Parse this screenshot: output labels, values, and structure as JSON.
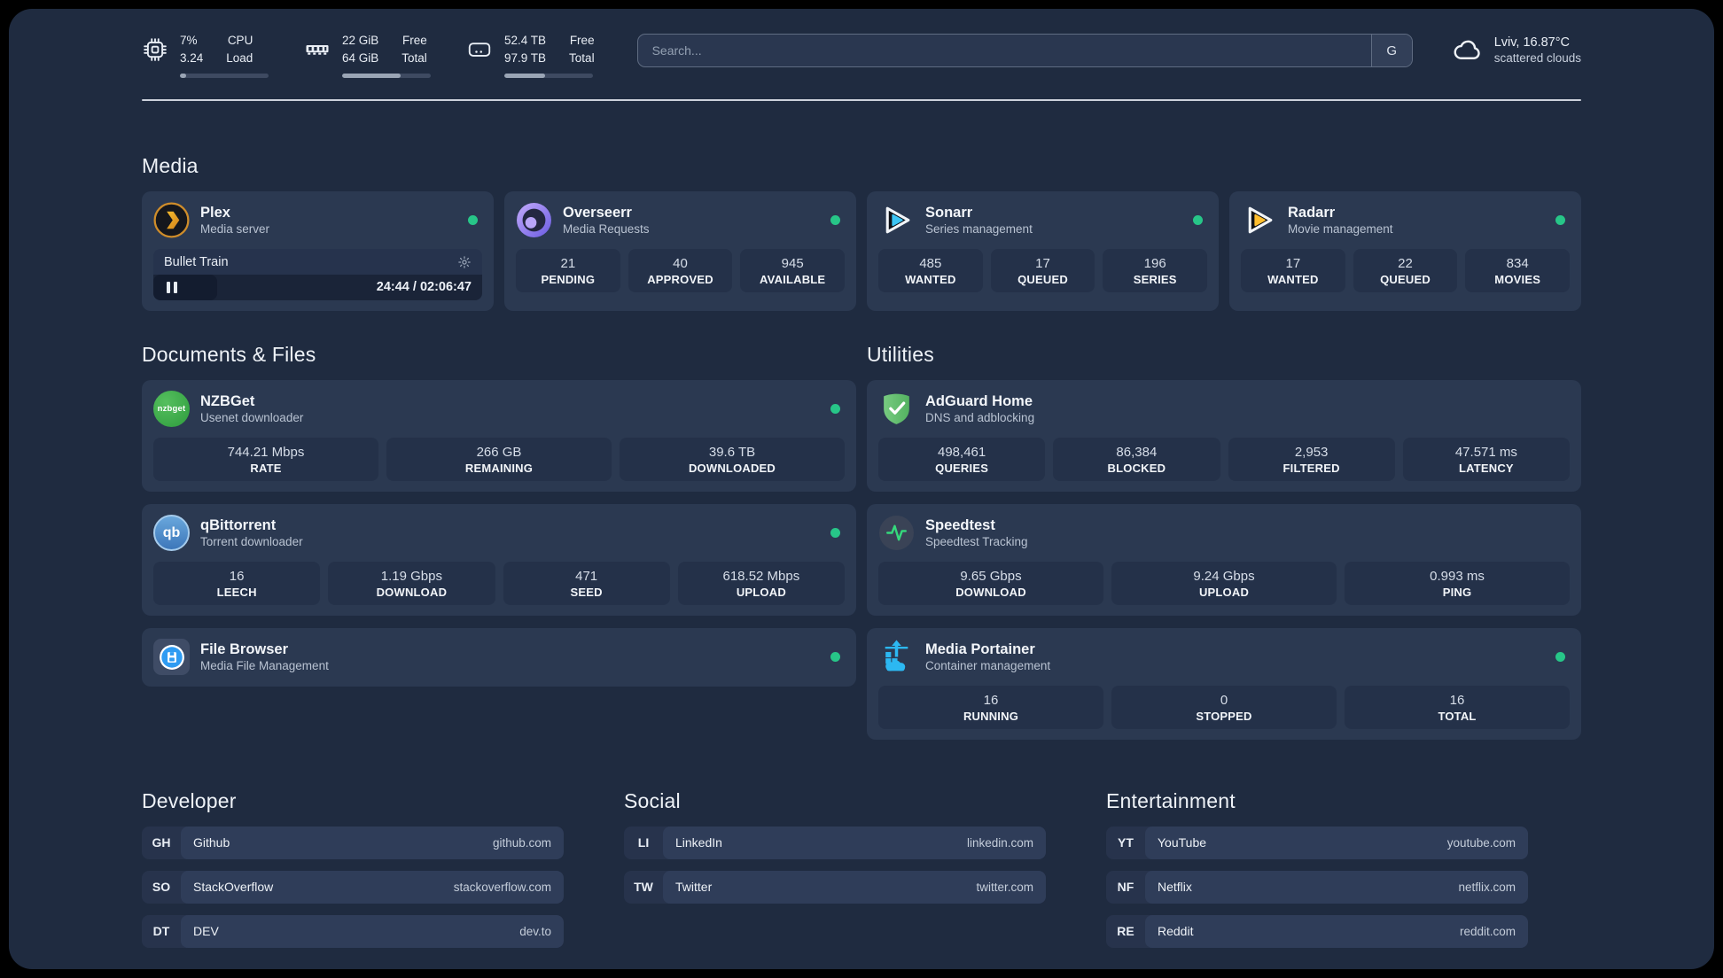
{
  "colors": {
    "status_online": "#27c688",
    "accent_background": "#1f2b40"
  },
  "header": {
    "system_stats": [
      {
        "icon": "cpu-icon",
        "value_top": "7%",
        "value_bottom": "3.24",
        "label_top": "CPU",
        "label_bottom": "Load",
        "progress_pct": 7
      },
      {
        "icon": "memory-icon",
        "value_top": "22 GiB",
        "value_bottom": "64 GiB",
        "label_top": "Free",
        "label_bottom": "Total",
        "progress_pct": 66
      },
      {
        "icon": "disk-icon",
        "value_top": "52.4 TB",
        "value_bottom": "97.9 TB",
        "label_top": "Free",
        "label_bottom": "Total",
        "progress_pct": 46
      }
    ],
    "search": {
      "placeholder": "Search...",
      "engine_button": "G"
    },
    "weather": {
      "location_temp": "Lviv, 16.87°C",
      "condition": "scattered clouds"
    }
  },
  "media": {
    "title": "Media",
    "plex": {
      "name": "Plex",
      "subtitle": "Media server",
      "now_playing": {
        "title": "Bullet Train",
        "time": "24:44 / 02:06:47"
      }
    },
    "overseerr": {
      "name": "Overseerr",
      "subtitle": "Media Requests",
      "stats": [
        {
          "value": "21",
          "label": "PENDING"
        },
        {
          "value": "40",
          "label": "APPROVED"
        },
        {
          "value": "945",
          "label": "AVAILABLE"
        }
      ]
    },
    "sonarr": {
      "name": "Sonarr",
      "subtitle": "Series management",
      "stats": [
        {
          "value": "485",
          "label": "WANTED"
        },
        {
          "value": "17",
          "label": "QUEUED"
        },
        {
          "value": "196",
          "label": "SERIES"
        }
      ]
    },
    "radarr": {
      "name": "Radarr",
      "subtitle": "Movie management",
      "stats": [
        {
          "value": "17",
          "label": "WANTED"
        },
        {
          "value": "22",
          "label": "QUEUED"
        },
        {
          "value": "834",
          "label": "MOVIES"
        }
      ]
    }
  },
  "documents": {
    "title": "Documents & Files",
    "nzbget": {
      "name": "NZBGet",
      "subtitle": "Usenet downloader",
      "icon_text": "nzbget",
      "stats": [
        {
          "value": "744.21 Mbps",
          "label": "RATE"
        },
        {
          "value": "266 GB",
          "label": "REMAINING"
        },
        {
          "value": "39.6 TB",
          "label": "DOWNLOADED"
        }
      ]
    },
    "qbittorrent": {
      "name": "qBittorrent",
      "subtitle": "Torrent downloader",
      "icon_text": "qb",
      "stats": [
        {
          "value": "16",
          "label": "LEECH"
        },
        {
          "value": "1.19 Gbps",
          "label": "DOWNLOAD"
        },
        {
          "value": "471",
          "label": "SEED"
        },
        {
          "value": "618.52 Mbps",
          "label": "UPLOAD"
        }
      ]
    },
    "filebrowser": {
      "name": "File Browser",
      "subtitle": "Media File Management"
    }
  },
  "utilities": {
    "title": "Utilities",
    "adguard": {
      "name": "AdGuard Home",
      "subtitle": "DNS and adblocking",
      "stats": [
        {
          "value": "498,461",
          "label": "QUERIES"
        },
        {
          "value": "86,384",
          "label": "BLOCKED"
        },
        {
          "value": "2,953",
          "label": "FILTERED"
        },
        {
          "value": "47.571 ms",
          "label": "LATENCY"
        }
      ]
    },
    "speedtest": {
      "name": "Speedtest",
      "subtitle": "Speedtest Tracking",
      "stats": [
        {
          "value": "9.65 Gbps",
          "label": "DOWNLOAD"
        },
        {
          "value": "9.24 Gbps",
          "label": "UPLOAD"
        },
        {
          "value": "0.993 ms",
          "label": "PING"
        }
      ]
    },
    "portainer": {
      "name": "Media Portainer",
      "subtitle": "Container management",
      "stats": [
        {
          "value": "16",
          "label": "RUNNING"
        },
        {
          "value": "0",
          "label": "STOPPED"
        },
        {
          "value": "16",
          "label": "TOTAL"
        }
      ]
    }
  },
  "links": {
    "developer": {
      "title": "Developer",
      "items": [
        {
          "abbr": "GH",
          "label": "Github",
          "url": "github.com"
        },
        {
          "abbr": "SO",
          "label": "StackOverflow",
          "url": "stackoverflow.com"
        },
        {
          "abbr": "DT",
          "label": "DEV",
          "url": "dev.to"
        }
      ]
    },
    "social": {
      "title": "Social",
      "items": [
        {
          "abbr": "LI",
          "label": "LinkedIn",
          "url": "linkedin.com"
        },
        {
          "abbr": "TW",
          "label": "Twitter",
          "url": "twitter.com"
        }
      ]
    },
    "entertainment": {
      "title": "Entertainment",
      "items": [
        {
          "abbr": "YT",
          "label": "YouTube",
          "url": "youtube.com"
        },
        {
          "abbr": "NF",
          "label": "Netflix",
          "url": "netflix.com"
        },
        {
          "abbr": "RE",
          "label": "Reddit",
          "url": "reddit.com"
        }
      ]
    }
  }
}
